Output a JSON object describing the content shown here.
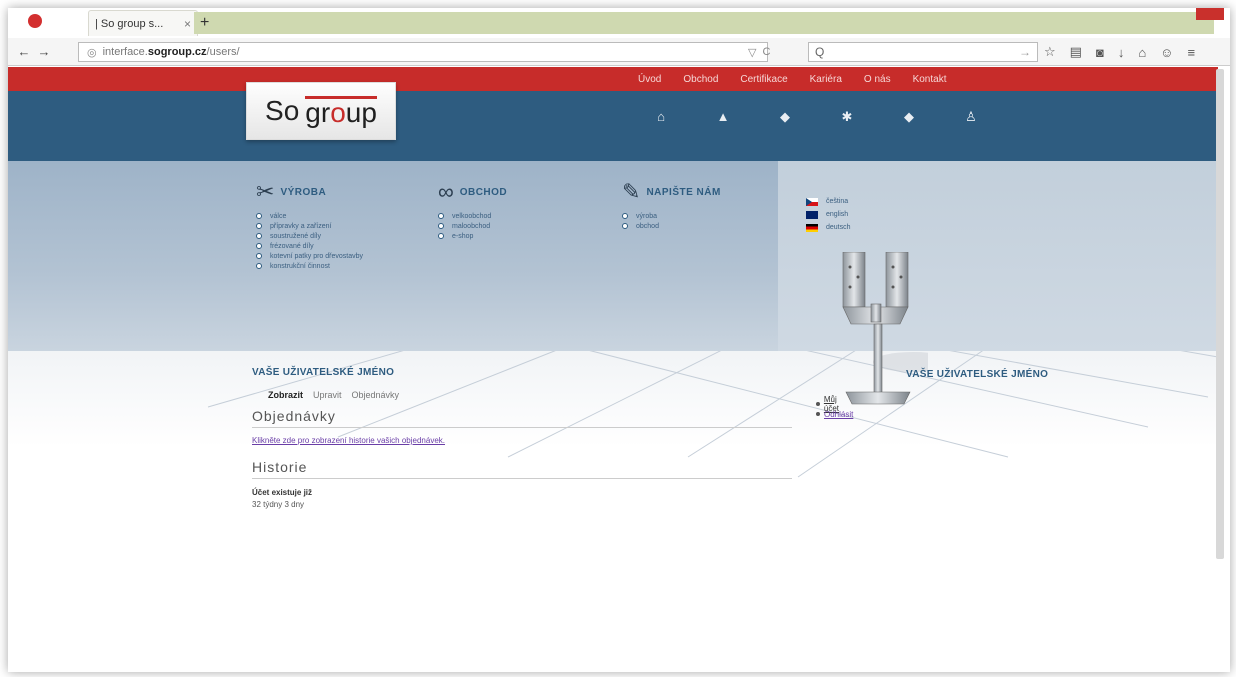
{
  "browser": {
    "tab_title": "| So group s...",
    "tab_close": "×",
    "new_tab": "+",
    "url_prefix": "interface.",
    "url_domain": "sogroup.cz",
    "url_path": "/users/",
    "url_dropdown": "▽",
    "url_reload": "C",
    "search_placeholder": "Q",
    "search_go": "→"
  },
  "site": {
    "logo_so": "So",
    "logo_gr": "gr",
    "logo_o": "o",
    "logo_up": "up",
    "top_menu": [
      "Úvod",
      "Obchod",
      "Certifikace",
      "Kariéra",
      "O nás",
      "Kontakt"
    ]
  },
  "menus": {
    "vyroba": {
      "title": "VÝROBA",
      "items": [
        "válce",
        "přípravky a zařízení",
        "soustružené díly",
        "frézované díly",
        "kotevní patky pro dřevostavby",
        "konstrukční činnost"
      ]
    },
    "obchod": {
      "title": "OBCHOD",
      "items": [
        "velkoobchod",
        "maloobchod",
        "e-shop"
      ]
    },
    "napiste": {
      "title": "NAPIŠTE NÁM",
      "items": [
        "výroba",
        "obchod"
      ]
    }
  },
  "languages": [
    "čeština",
    "english",
    "deutsch"
  ],
  "content": {
    "username_heading": "VAŠE UŽIVATELSKÉ JMÉNO",
    "tabs": {
      "view": "Zobrazit",
      "edit": "Upravit",
      "orders": "Objednávky"
    },
    "orders_heading": "Objednávky",
    "orders_link": "Klikněte zde pro zobrazení historie vašich objednávek.",
    "history_heading": "Historie",
    "account_label": "Účet existuje již",
    "account_value": "32 týdny 3 dny"
  },
  "sidebar": {
    "heading": "VAŠE UŽIVATELSKÉ JMÉNO",
    "my_account": "Můj účet",
    "logout": "Odhlásit"
  }
}
